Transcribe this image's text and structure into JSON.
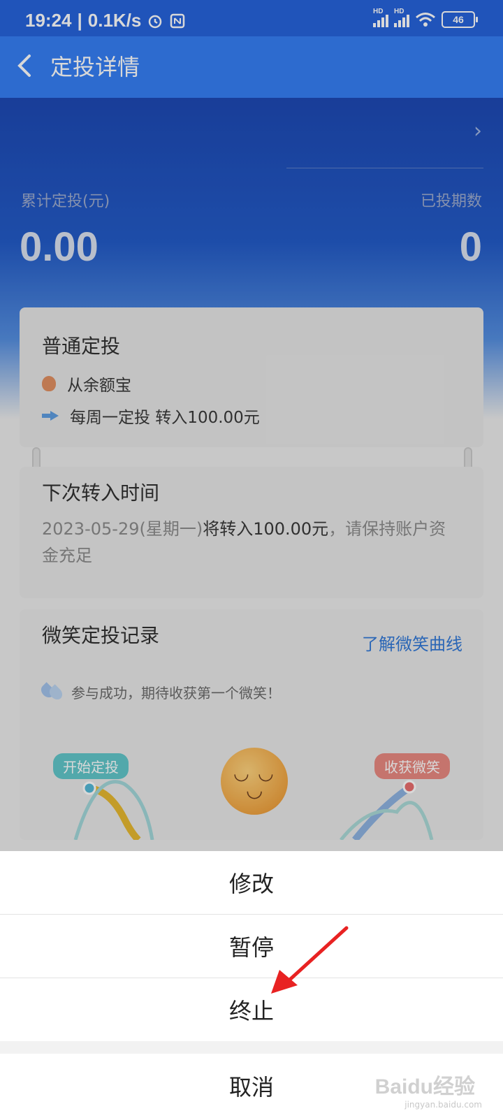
{
  "status_bar": {
    "time": "19:24",
    "speed": "0.1K/s",
    "battery": "46",
    "icons": [
      "alarm-icon",
      "nfc-icon",
      "signal-hd-icon",
      "signal-hd-icon",
      "wifi-icon",
      "battery-icon"
    ]
  },
  "nav": {
    "title": "定投详情",
    "back_icon": "back-chevron-icon"
  },
  "summary": {
    "total_label": "累计定投(元)",
    "total_value": "0.00",
    "periods_label": "已投期数",
    "periods_value": "0"
  },
  "plan": {
    "title": "普通定投",
    "source": "从余额宝",
    "schedule": "每周一定投 转入100.00元"
  },
  "next": {
    "title": "下次转入时间",
    "desc_gray": "2023-05-29(星期一)",
    "desc_dark": "将转入100.00元",
    "desc_tail": "，请保持账户资金充足"
  },
  "record": {
    "title": "微笑定投记录",
    "link": "了解微笑曲线",
    "tip": "参与成功，期待收获第一个微笑！",
    "tag_start": "开始定投",
    "tag_end": "收获微笑"
  },
  "sheet": {
    "options": [
      "修改",
      "暂停",
      "终止"
    ],
    "cancel": "取消"
  },
  "watermark": {
    "brand": "Baidu经验",
    "url": "jingyan.baidu.com"
  },
  "colors": {
    "navbar": "#2f7bf5",
    "hero": "#1c56c6",
    "link": "#2b74d6",
    "annotation_arrow": "#e82222"
  }
}
